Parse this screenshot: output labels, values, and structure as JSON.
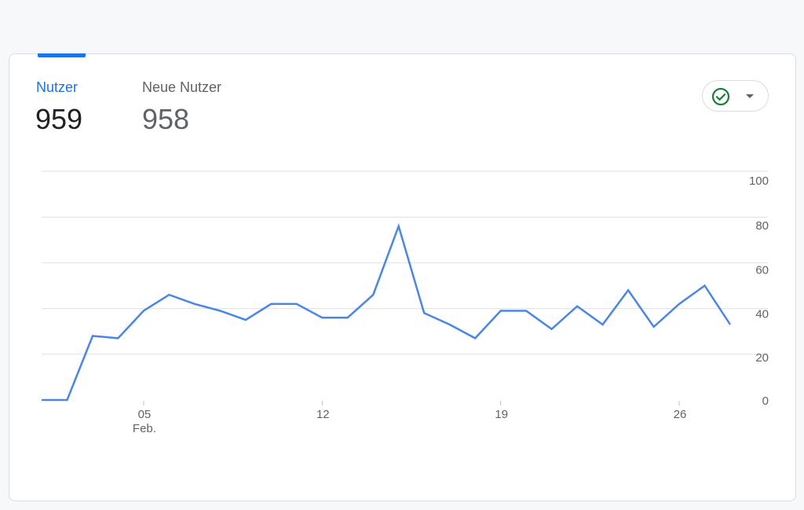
{
  "metrics": [
    {
      "label": "Nutzer",
      "value": "959"
    },
    {
      "label": "Neue Nutzer",
      "value": "958"
    }
  ],
  "status_button": {
    "icon": "check-circle-icon",
    "menu_icon": "caret-down-icon",
    "check_color": "#188038"
  },
  "colors": {
    "accent": "#1a73e8",
    "line": "#4a86e8",
    "grid": "#e0e0e0"
  },
  "chart_data": {
    "type": "line",
    "title": "",
    "xlabel": "",
    "ylabel": "",
    "ylim": [
      0,
      100
    ],
    "y_ticks": [
      0,
      20,
      40,
      60,
      80,
      100
    ],
    "y_axis_side": "right",
    "grid": true,
    "x_ticks": [
      {
        "day": 5,
        "label": "05",
        "sublabel": "Feb."
      },
      {
        "day": 12,
        "label": "12",
        "sublabel": ""
      },
      {
        "day": 19,
        "label": "19",
        "sublabel": ""
      },
      {
        "day": 26,
        "label": "26",
        "sublabel": ""
      }
    ],
    "x": [
      1,
      2,
      3,
      4,
      5,
      6,
      7,
      8,
      9,
      10,
      11,
      12,
      13,
      14,
      15,
      16,
      17,
      18,
      19,
      20,
      21,
      22,
      23,
      24,
      25,
      26,
      27,
      28
    ],
    "series": [
      {
        "name": "",
        "values": [
          0,
          0,
          28,
          27,
          39,
          46,
          42,
          39,
          35,
          42,
          42,
          36,
          36,
          46,
          76,
          38,
          33,
          27,
          39,
          39,
          31,
          41,
          33,
          48,
          32,
          42,
          50,
          33
        ]
      }
    ]
  }
}
